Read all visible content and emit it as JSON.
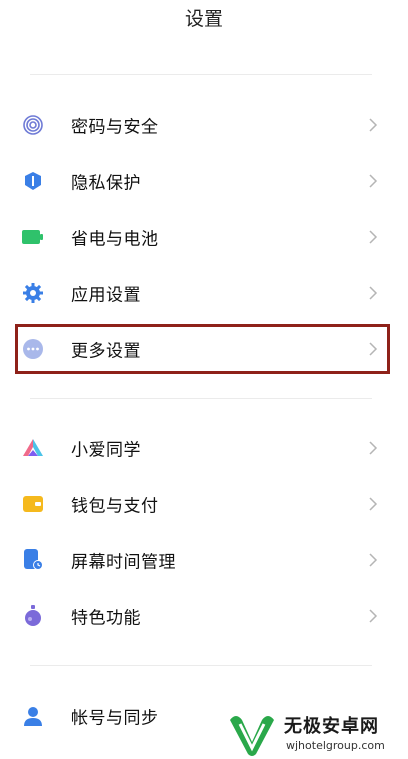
{
  "header": {
    "title": "设置"
  },
  "groups": [
    {
      "items": [
        {
          "label": "密码与安全",
          "icon": "fingerprint-icon"
        },
        {
          "label": "隐私保护",
          "icon": "privacy-shield-icon"
        },
        {
          "label": "省电与电池",
          "icon": "battery-icon"
        },
        {
          "label": "应用设置",
          "icon": "gear-icon"
        },
        {
          "label": "更多设置",
          "icon": "more-dots-icon"
        }
      ]
    },
    {
      "items": [
        {
          "label": "小爱同学",
          "icon": "xiaoai-icon"
        },
        {
          "label": "钱包与支付",
          "icon": "wallet-icon"
        },
        {
          "label": "屏幕时间管理",
          "icon": "screen-time-icon"
        },
        {
          "label": "特色功能",
          "icon": "special-features-icon"
        }
      ]
    },
    {
      "items": [
        {
          "label": "帐号与同步",
          "icon": "account-icon"
        }
      ]
    }
  ],
  "watermark": {
    "name": "无极安卓网",
    "url": "wjhotelgroup.com"
  },
  "colors": {
    "highlight": "#8e2119",
    "accent_blue": "#3a7fe6",
    "battery_green": "#2fc26b",
    "wallet_yellow": "#f5b91d",
    "purple": "#7b6ad9"
  }
}
